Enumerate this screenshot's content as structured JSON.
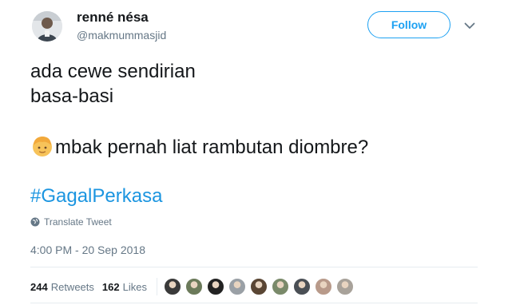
{
  "author": {
    "display_name": "renné nésa",
    "screen_name": "@makmummasjid"
  },
  "header": {
    "follow_label": "Follow"
  },
  "tweet": {
    "lines": [
      "ada cewe sendirian",
      "basa-basi",
      "mbak pernah liat rambutan diombre?"
    ],
    "hashtag": "#GagalPerkasa",
    "translate_label": "Translate Tweet",
    "timestamp": "4:00 PM - 20 Sep 2018"
  },
  "stats": {
    "retweets_count": "244",
    "retweets_label": "Retweets",
    "likes_count": "162",
    "likes_label": "Likes"
  },
  "icons": {
    "emoji": "blond-person-emoji",
    "translate": "globe-icon",
    "caret": "chevron-down-icon"
  },
  "colors": {
    "accent": "#1da1f2",
    "hashtag": "#1b95e0",
    "muted": "#657786",
    "text": "#14171a"
  },
  "likers": [
    {
      "color": "#3a3a3a"
    },
    {
      "color": "#6b7a5a"
    },
    {
      "color": "#222222"
    },
    {
      "color": "#9aa0a6"
    },
    {
      "color": "#5a4634"
    },
    {
      "color": "#7a8a6a"
    },
    {
      "color": "#4a4f55"
    },
    {
      "color": "#b89a8a"
    },
    {
      "color": "#a8a29a"
    }
  ]
}
